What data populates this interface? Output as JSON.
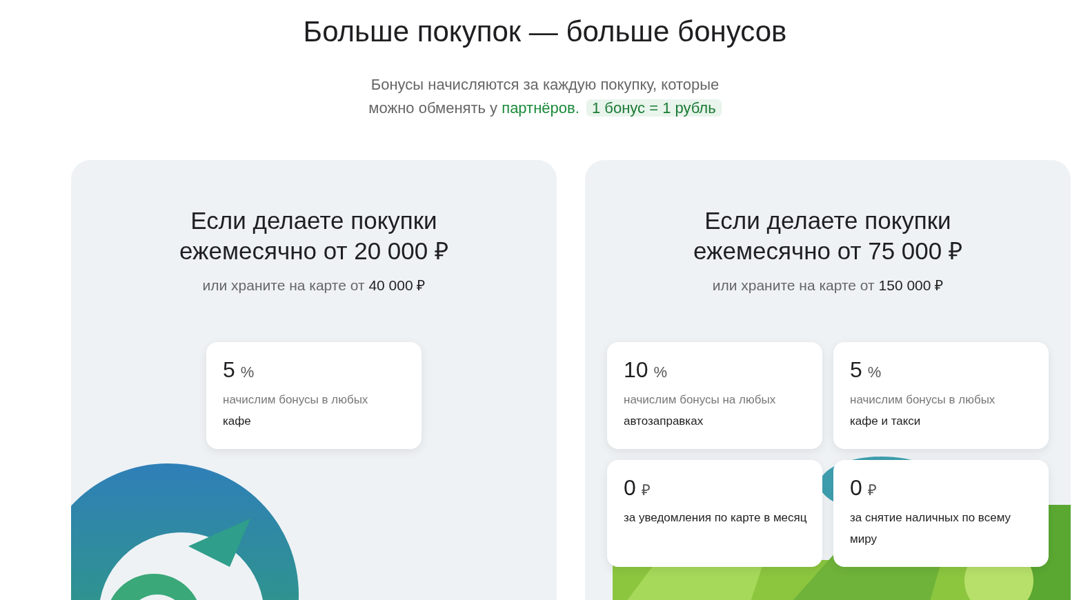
{
  "title": "Больше покупок — больше бонусов",
  "subtitle": {
    "text": "Бонусы начисляются за каждую покупку, которые можно обменять у ",
    "link": "партнёров.",
    "badge": "1 бонус = 1 рубль"
  },
  "plans": [
    {
      "heading": "Если делаете покупки ежемесячно от 20 000 ₽",
      "sub": "или храните на карте от ",
      "sub_amount": "40 000 ₽",
      "tiles": [
        {
          "value": "5",
          "unit": "%",
          "note": "начислим бонусы в любых",
          "text": "кафе"
        }
      ]
    },
    {
      "heading": "Если делаете покупки ежемесячно от 75 000 ₽",
      "sub": "или храните на карте от ",
      "sub_amount": "150 000 ₽",
      "tiles": [
        {
          "value": "10",
          "unit": "%",
          "note": "начислим бонусы на любых",
          "text": "автозаправках"
        },
        {
          "value": "5",
          "unit": "%",
          "note": "начислим бонусы в любых",
          "text": "кафе и такси"
        },
        {
          "value": "0",
          "unit": "₽",
          "text": "за уведомления по карте в месяц"
        },
        {
          "value": "0",
          "unit": "₽",
          "text": "за снятие наличных по всему миру"
        }
      ]
    }
  ]
}
